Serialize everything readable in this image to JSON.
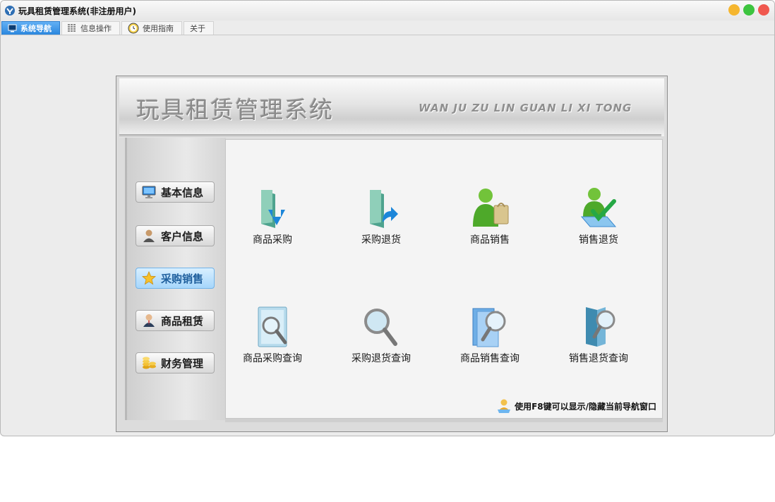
{
  "window": {
    "title": "玩具租赁管理系统(非注册用户)",
    "icon": "app-logo-icon"
  },
  "tabs": [
    {
      "label": "系统导航",
      "icon": "monitor-icon",
      "active": true
    },
    {
      "label": "信息操作",
      "icon": "grid-icon",
      "active": false
    },
    {
      "label": "使用指南",
      "icon": "clock-icon",
      "active": false
    },
    {
      "label": "关于",
      "icon": "",
      "active": false
    }
  ],
  "banner": {
    "title": "玩具租赁管理系统",
    "subtitle": "WAN JU ZU LIN GUAN LI XI TONG"
  },
  "sidebar": {
    "items": [
      {
        "label": "基本信息",
        "icon": "monitor-icon",
        "active": false
      },
      {
        "label": "客户信息",
        "icon": "user-icon",
        "active": false
      },
      {
        "label": "采购销售",
        "icon": "star-icon",
        "active": true
      },
      {
        "label": "商品租赁",
        "icon": "businessman-icon",
        "active": false
      },
      {
        "label": "财务管理",
        "icon": "coins-icon",
        "active": false
      }
    ]
  },
  "grid": {
    "items": [
      {
        "label": "商品采购",
        "icon": "folder-download-icon"
      },
      {
        "label": "采购退货",
        "icon": "folder-return-icon"
      },
      {
        "label": "商品销售",
        "icon": "user-shopping-bag-icon"
      },
      {
        "label": "销售退货",
        "icon": "user-checkmark-icon"
      },
      {
        "label": "商品采购查询",
        "icon": "document-search-icon"
      },
      {
        "label": "采购退货查询",
        "icon": "magnifier-icon"
      },
      {
        "label": "商品销售查询",
        "icon": "folder-search-icon"
      },
      {
        "label": "销售退货查询",
        "icon": "book-search-icon"
      }
    ]
  },
  "hint": {
    "text": "使用F8键可以显示/隐藏当前导航窗口",
    "icon": "user-hint-icon"
  },
  "colors": {
    "tab_active": "#2a86dd",
    "nav_active": "#a6d6fb"
  }
}
